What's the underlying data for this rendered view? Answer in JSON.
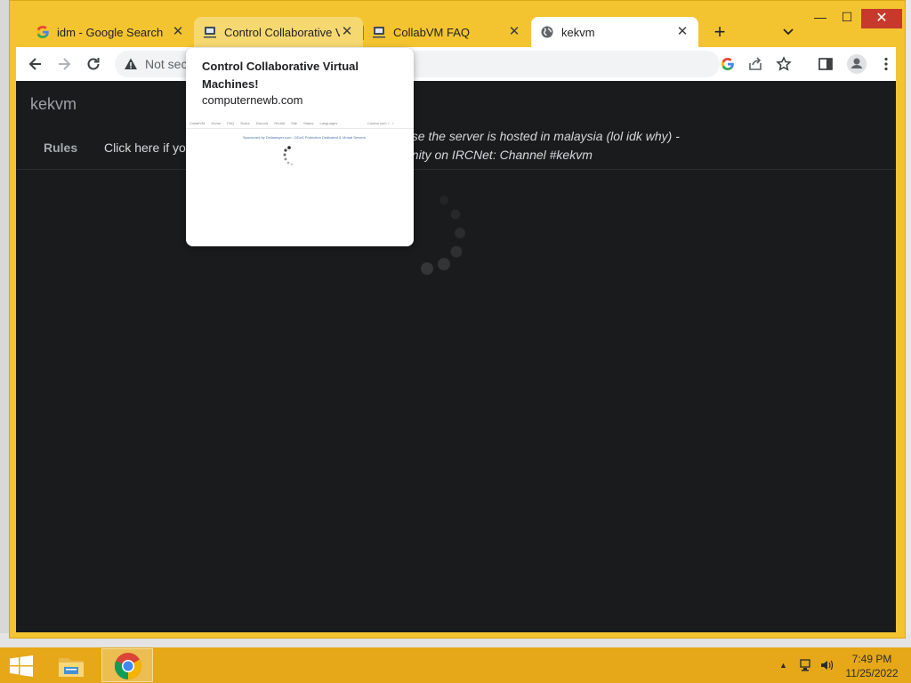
{
  "browser": {
    "tabs": [
      {
        "title": "idm - Google Search",
        "icon": "google-icon"
      },
      {
        "title": "Control Collaborative Virtual Machines!",
        "icon": "collabvm-icon"
      },
      {
        "title": "CollabVM FAQ",
        "icon": "collabvm-icon"
      },
      {
        "title": "kekvm",
        "icon": "globe-icon"
      }
    ],
    "active_tab_index": 3,
    "window_controls": {
      "minimize": "—",
      "maximize": "☐",
      "close": "✕"
    },
    "new_tab": "+",
    "omnibox": {
      "security_text": "Not sec"
    },
    "accent_color": "#f4c430"
  },
  "hovercard": {
    "title": "Control Collaborative Virtual Machines!",
    "domain": "computernewb.com",
    "preview_nav": "CollabVM Home FAQ Rules Discord Reddit Site Status Languages",
    "preview_nav_right": "Control vm0 ✓ ✓",
    "preview_sponsor": "Sponsored by Dellamayer.com - DDoS Protection Dedicated & Virtual Servers"
  },
  "page": {
    "brand": "kekvm",
    "nav_rules": "Rules",
    "nav_click": "Click here if yo",
    "motd_line1": "use the server is hosted in malaysia (lol idk why) -",
    "motd_line2": "unity on IRCNet: Channel #kekvm",
    "background": "#1a1b1d"
  },
  "taskbar": {
    "time": "7:49 PM",
    "date": "11/25/2022",
    "color": "#e6a818"
  }
}
